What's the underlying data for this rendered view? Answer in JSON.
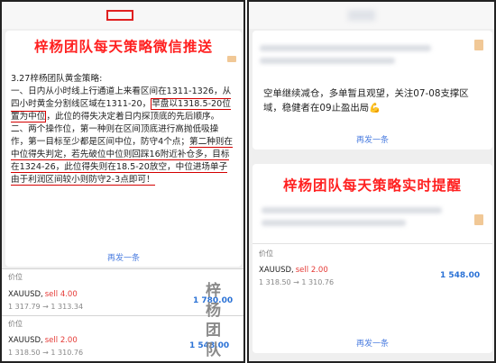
{
  "left": {
    "banner": "梓杨团队每天策略微信推送",
    "article": {
      "title": "3.27梓杨团队黄金策略:",
      "p1a": "一、日内从小时线上行通道上来看区间在1311-1326，从四小时黄金分割线区域在1311-20，",
      "p1_hl": "早盘以1318.5-20位置为中位",
      "p1b": "，此位的得失决定着日内探顶底的先后顺序。",
      "p2a": "二、两个操作位，第一种则在区间顶底进行高抛低吸操作，第一目标至少都是区间中位，防守4个点；",
      "p2_ul": "第二种则在中位得失判定，若先破位中位则回踩16附近补仓多，目标在1324-26，此位得失则在18.5-20放空，中位进场单子由于利润区间较小则防守2-3点即可！"
    },
    "more": "再发一条",
    "price_label": "价位",
    "orders": [
      {
        "symbol": "XAUUSD,",
        "side": "sell 4.00",
        "range": "1 317.79 → 1 313.34",
        "price": "1 780.00"
      },
      {
        "symbol": "XAUUSD,",
        "side": "sell 2.00",
        "range": "1 318.50 → 1 310.76",
        "price": "1 548.00"
      }
    ],
    "watermark": [
      "梓",
      "杨",
      "团",
      "队"
    ]
  },
  "right": {
    "message": "空单继续减仓，多单暂且观望，关注07-08支撑区域，稳健者在09止盈出局",
    "emoji": "💪",
    "more": "再发一条",
    "banner": "梓杨团队每天策略实时提醒",
    "price_label": "价位",
    "order": {
      "symbol": "XAUUSD,",
      "side": "sell 2.00",
      "range": "1 318.50 → 1 310.76",
      "price": "1 548.00"
    },
    "more2": "再发一条"
  }
}
